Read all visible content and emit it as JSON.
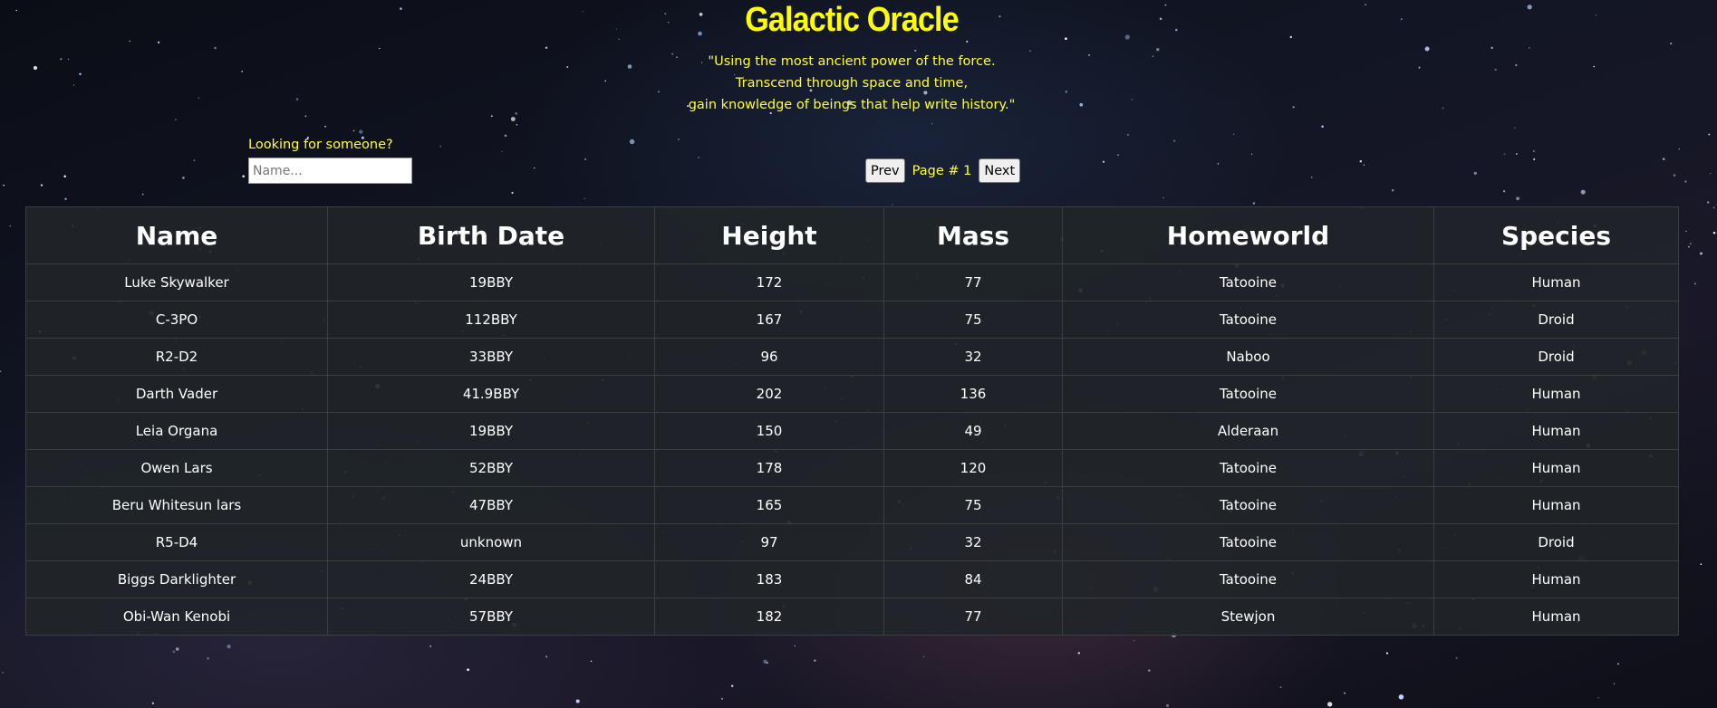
{
  "header": {
    "title": "Galactic Oracle",
    "quote_lines": [
      "\"Using the most ancient power of the force.",
      "Transcend through space and time,",
      "gain knowledge of beings that help write history.\""
    ]
  },
  "search": {
    "label": "Looking for someone?",
    "placeholder": "Name...",
    "value": ""
  },
  "pagination": {
    "prev_label": "Prev",
    "page_label": "Page # 1",
    "next_label": "Next"
  },
  "table": {
    "columns": [
      "Name",
      "Birth Date",
      "Height",
      "Mass",
      "Homeworld",
      "Species"
    ],
    "rows": [
      [
        "Luke Skywalker",
        "19BBY",
        "172",
        "77",
        "Tatooine",
        "Human"
      ],
      [
        "C-3PO",
        "112BBY",
        "167",
        "75",
        "Tatooine",
        "Droid"
      ],
      [
        "R2-D2",
        "33BBY",
        "96",
        "32",
        "Naboo",
        "Droid"
      ],
      [
        "Darth Vader",
        "41.9BBY",
        "202",
        "136",
        "Tatooine",
        "Human"
      ],
      [
        "Leia Organa",
        "19BBY",
        "150",
        "49",
        "Alderaan",
        "Human"
      ],
      [
        "Owen Lars",
        "52BBY",
        "178",
        "120",
        "Tatooine",
        "Human"
      ],
      [
        "Beru Whitesun lars",
        "47BBY",
        "165",
        "75",
        "Tatooine",
        "Human"
      ],
      [
        "R5-D4",
        "unknown",
        "97",
        "32",
        "Tatooine",
        "Droid"
      ],
      [
        "Biggs Darklighter",
        "24BBY",
        "183",
        "84",
        "Tatooine",
        "Human"
      ],
      [
        "Obi-Wan Kenobi",
        "57BBY",
        "182",
        "77",
        "Stewjon",
        "Human"
      ]
    ]
  },
  "colors": {
    "accent_yellow": "#ffff00",
    "table_bg": "#212529",
    "table_border": "#3b3f44"
  }
}
